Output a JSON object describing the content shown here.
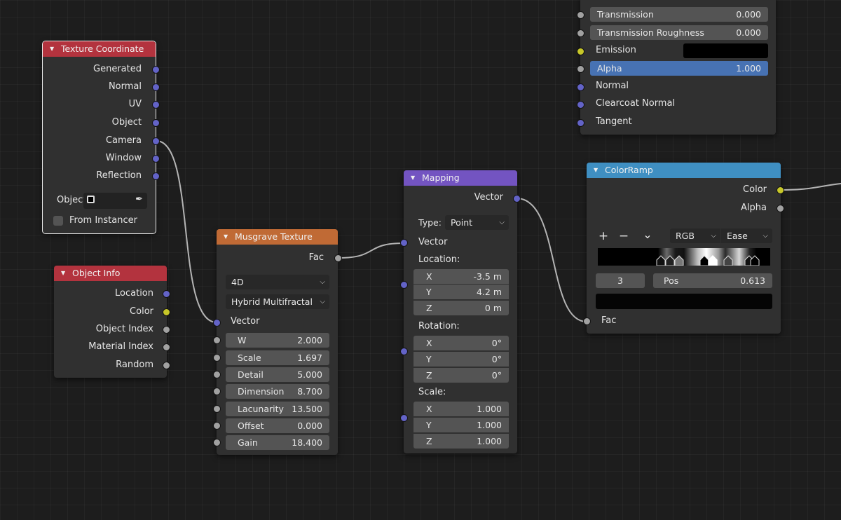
{
  "colors": {
    "header_input": "#b3333e",
    "header_texture": "#c06a35",
    "header_vector": "#7354c1",
    "header_converter": "#3f8fc2",
    "socket_vector": "#6363c7",
    "socket_float": "#a1a1a1",
    "socket_color": "#c7c729",
    "alpha_highlight": "#4772b3"
  },
  "principled": {
    "outputs": [
      {
        "label": "Transmission",
        "value": "0.000"
      },
      {
        "label": "Transmission Roughness",
        "value": "0.000"
      }
    ],
    "emission_label": "Emission",
    "alpha": {
      "label": "Alpha",
      "value": "1.000"
    },
    "normal_label": "Normal",
    "clearcoat_normal_label": "Clearcoat Normal",
    "tangent_label": "Tangent"
  },
  "texture_coordinate": {
    "title": "Texture Coordinate",
    "outputs": [
      "Generated",
      "Normal",
      "UV",
      "Object",
      "Camera",
      "Window",
      "Reflection"
    ],
    "object_label": "Object",
    "from_instancer_label": "From Instancer"
  },
  "object_info": {
    "title": "Object Info",
    "outputs": [
      "Location",
      "Color",
      "Object Index",
      "Material Index",
      "Random"
    ]
  },
  "musgrave": {
    "title": "Musgrave Texture",
    "output": "Fac",
    "dimensions": "4D",
    "type": "Hybrid Multifractal",
    "vector_label": "Vector",
    "params": [
      {
        "label": "W",
        "value": "2.000"
      },
      {
        "label": "Scale",
        "value": "1.697"
      },
      {
        "label": "Detail",
        "value": "5.000"
      },
      {
        "label": "Dimension",
        "value": "8.700"
      },
      {
        "label": "Lacunarity",
        "value": "13.500"
      },
      {
        "label": "Offset",
        "value": "0.000"
      },
      {
        "label": "Gain",
        "value": "18.400"
      }
    ]
  },
  "mapping": {
    "title": "Mapping",
    "output": "Vector",
    "type_label": "Type:",
    "type_value": "Point",
    "vector_label": "Vector",
    "location_label": "Location:",
    "location": [
      {
        "axis": "X",
        "value": "-3.5 m"
      },
      {
        "axis": "Y",
        "value": "4.2 m"
      },
      {
        "axis": "Z",
        "value": "0 m"
      }
    ],
    "rotation_label": "Rotation:",
    "rotation": [
      {
        "axis": "X",
        "value": "0°"
      },
      {
        "axis": "Y",
        "value": "0°"
      },
      {
        "axis": "Z",
        "value": "0°"
      }
    ],
    "scale_label": "Scale:",
    "scale": [
      {
        "axis": "X",
        "value": "1.000"
      },
      {
        "axis": "Y",
        "value": "1.000"
      },
      {
        "axis": "Z",
        "value": "1.000"
      }
    ]
  },
  "colorramp": {
    "title": "ColorRamp",
    "outputs": [
      "Color",
      "Alpha"
    ],
    "add_icon": "+",
    "remove_icon": "−",
    "menu_icon": "⌄",
    "color_mode": "RGB",
    "interpolation": "Ease",
    "active_index": "3",
    "pos_label": "Pos",
    "pos_value": "0.613",
    "input": "Fac"
  }
}
